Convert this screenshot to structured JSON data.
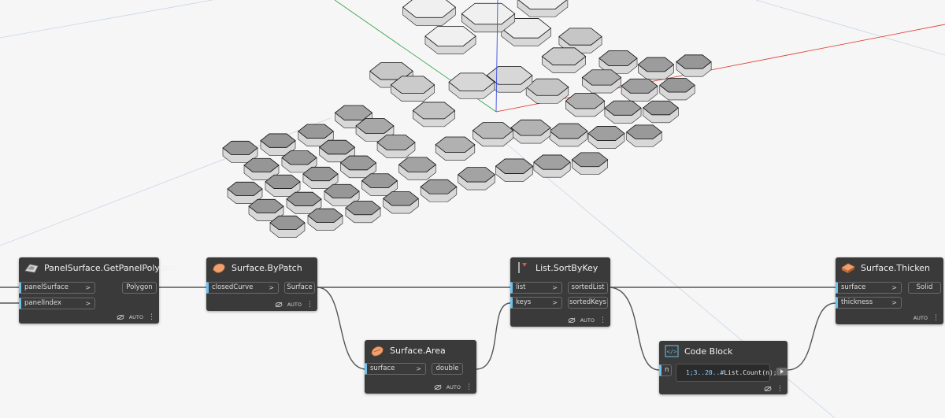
{
  "nodes": {
    "getpanelpolygon": {
      "title": "PanelSurface.GetPanelPolygon",
      "inputs": [
        "panelSurface",
        "panelIndex"
      ],
      "output": "Polygon",
      "lacing": "AUTO"
    },
    "bypatch": {
      "title": "Surface.ByPatch",
      "inputs": [
        "closedCurve"
      ],
      "output": "Surface",
      "lacing": "AUTO"
    },
    "area": {
      "title": "Surface.Area",
      "inputs": [
        "surface"
      ],
      "output": "double",
      "lacing": "AUTO"
    },
    "sortbykey": {
      "title": "List.SortByKey",
      "inputs": [
        "list",
        "keys"
      ],
      "outputs": [
        "sortedList",
        "sortedKeys"
      ],
      "lacing": "AUTO"
    },
    "codeblock": {
      "title": "Code Block",
      "input": "n",
      "code_numbers": "1;3..20..#",
      "code_rest": "List.Count(n);"
    },
    "thicken": {
      "title": "Surface.Thicken",
      "inputs": [
        "surface",
        "thickness"
      ],
      "output": "Solid",
      "lacing": "AUTO"
    }
  },
  "colors": {
    "canvas": "#f6f6f6",
    "node": "#3a3a3a",
    "port_accent": "#6ec1ea",
    "wire": "#555555",
    "axis_x": "#e0453a",
    "axis_y": "#3aa64a",
    "axis_z": "#3a4fe0",
    "geometry_top": "#b5b5b5",
    "geometry_side": "#d8d8d8"
  },
  "icons": {
    "getpanelpolygon": "panel-polygon-icon",
    "bypatch": "surface-patch-icon",
    "area": "surface-area-icon",
    "sortbykey": "sort-icon",
    "codeblock": "code-icon",
    "thicken": "thicken-icon",
    "lacing": "eye-off-icon",
    "menu": "dots-icon"
  }
}
